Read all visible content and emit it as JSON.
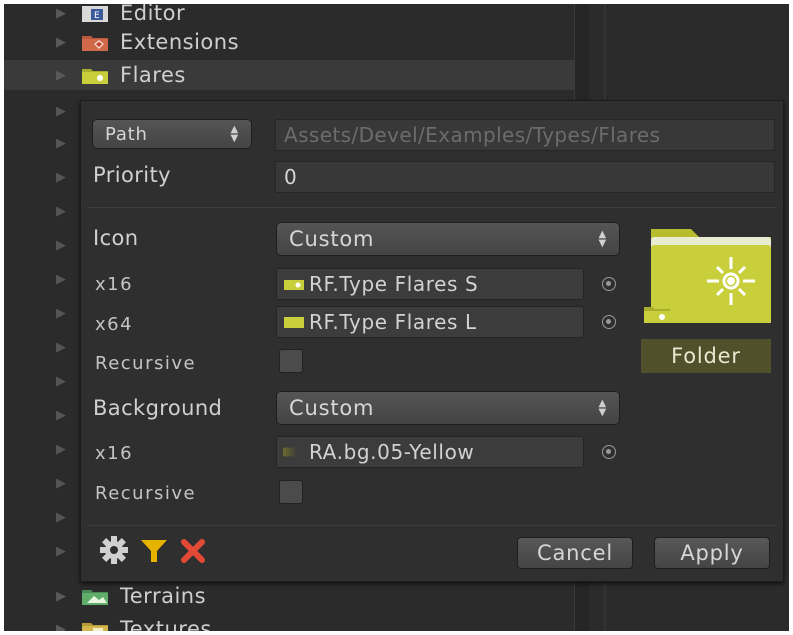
{
  "tree": {
    "items": [
      {
        "label": "Editor",
        "icon": "editor-folder-icon"
      },
      {
        "label": "Extensions",
        "icon": "extensions-folder-icon"
      },
      {
        "label": "Flares",
        "icon": "flares-folder-icon",
        "selected": true
      },
      {
        "label": "Terrains",
        "icon": "terrains-folder-icon"
      },
      {
        "label": "Textures",
        "icon": "textures-folder-icon"
      }
    ]
  },
  "panel": {
    "path_mode": "Path",
    "path_value": "Assets/Devel/Examples/Types/Flares",
    "priority_label": "Priority",
    "priority_value": "0",
    "icon": {
      "label": "Icon",
      "mode": "Custom",
      "x16_label": "x16",
      "x16_value": "RF.Type Flares S",
      "x64_label": "x64",
      "x64_value": "RF.Type Flares L",
      "recursive_label": "Recursive",
      "recursive_checked": false
    },
    "background": {
      "label": "Background",
      "mode": "Custom",
      "x16_label": "x16",
      "x16_value": "RA.bg.05-Yellow",
      "recursive_label": "Recursive",
      "recursive_checked": false
    },
    "preview": {
      "caption": "Folder",
      "folder_color": "#c9cf3a"
    },
    "footer": {
      "settings_icon": "gear-icon",
      "filter_icon": "filter-icon",
      "clear_icon": "close-icon",
      "cancel_label": "Cancel",
      "apply_label": "Apply"
    }
  },
  "colors": {
    "background": "#2b2b2b",
    "panel": "#2f2f2f",
    "accent_yellow": "#c9cf3a",
    "clear_red": "#e24a36",
    "filter_yellow": "#e6b400"
  }
}
